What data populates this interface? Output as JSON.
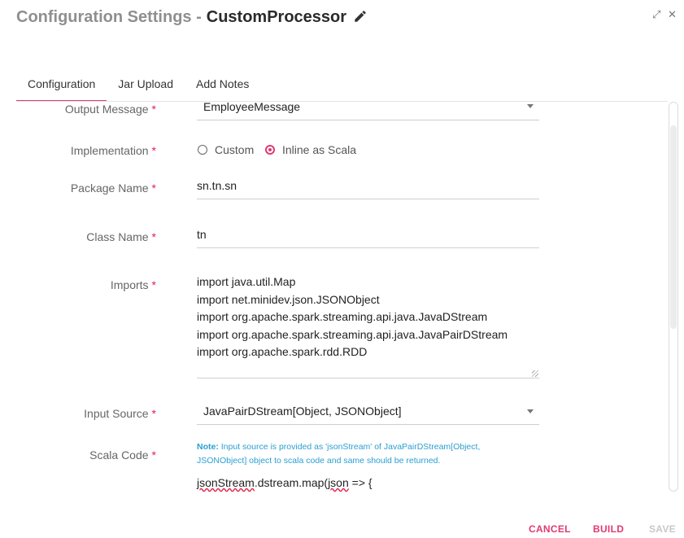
{
  "header": {
    "title_prefix": "Configuration Settings -",
    "title_name": "CustomProcessor",
    "expand_glyph": "⤢",
    "close_glyph": "✕"
  },
  "tabs": [
    {
      "label": "Configuration",
      "active": true
    },
    {
      "label": "Jar Upload",
      "active": false
    },
    {
      "label": "Add Notes",
      "active": false
    }
  ],
  "form": {
    "required_mark": "*",
    "output_message": {
      "label": "Output Message",
      "value": "EmployeeMessage"
    },
    "implementation": {
      "label": "Implementation",
      "options": [
        "Custom",
        "Inline as Scala"
      ],
      "selected": "Inline as Scala"
    },
    "package_name": {
      "label": "Package Name",
      "value": "sn.tn.sn"
    },
    "class_name": {
      "label": "Class Name",
      "value": "tn"
    },
    "imports": {
      "label": "Imports",
      "lines": [
        "import java.util.Map",
        "import net.minidev.json.JSONObject",
        "import org.apache.spark.streaming.api.java.JavaDStream",
        "import org.apache.spark.streaming.api.java.JavaPairDStream",
        "import org.apache.spark.rdd.RDD"
      ]
    },
    "input_source": {
      "label": "Input Source",
      "value": "JavaPairDStream[Object, JSONObject]"
    },
    "scala_code": {
      "label": "Scala Code",
      "note_label": "Note:",
      "note_text": "Input source is provided as 'jsonStream' of JavaPairDStream[Object, JSONObject] object to scala code and same should be returned.",
      "code_part1": "jsonStream",
      "code_part2": ".dstream.map(",
      "code_part3": "json",
      "code_part4": " => {"
    }
  },
  "footer": {
    "cancel": "CANCEL",
    "build": "BUILD",
    "save": "SAVE"
  },
  "colors": {
    "accent": "#e03a6f",
    "required": "#e0224c",
    "note": "#2b9fd1",
    "disabled": "#c8c8c8"
  }
}
